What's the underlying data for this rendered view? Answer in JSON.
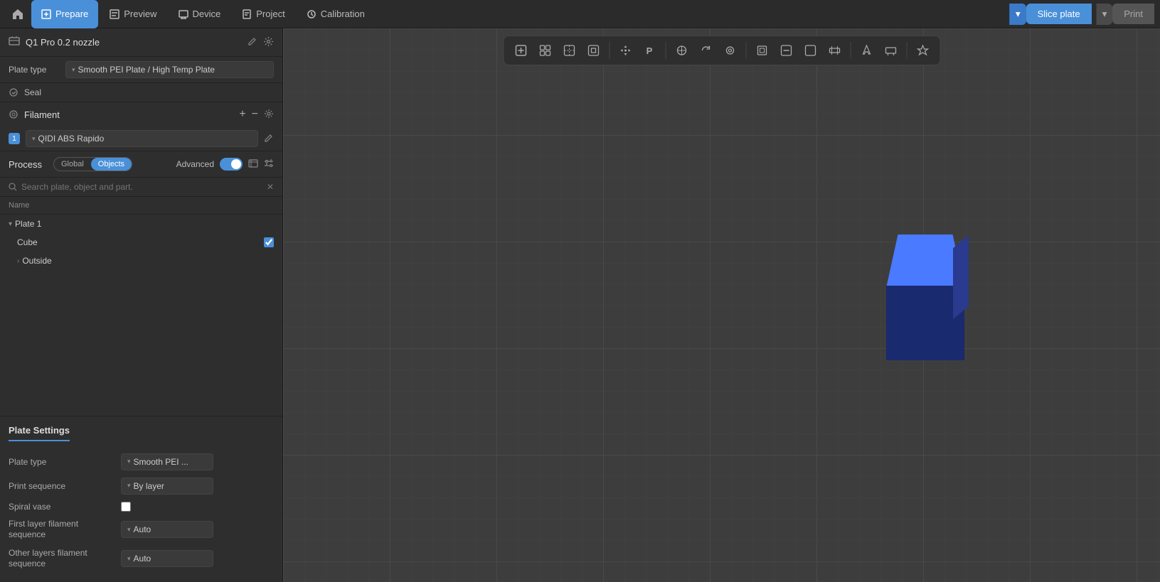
{
  "nav": {
    "home_icon": "⌂",
    "tabs": [
      {
        "id": "prepare",
        "label": "Prepare",
        "icon": "◻",
        "active": true
      },
      {
        "id": "preview",
        "label": "Preview",
        "icon": "◫",
        "active": false
      },
      {
        "id": "device",
        "label": "Device",
        "icon": "▣",
        "active": false
      },
      {
        "id": "project",
        "label": "Project",
        "icon": "◨",
        "active": false
      },
      {
        "id": "calibration",
        "label": "Calibration",
        "icon": "✦",
        "active": false
      }
    ],
    "slice_label": "Slice plate",
    "print_label": "Print"
  },
  "sidebar": {
    "printer_icon": "◻",
    "printer_name": "Q1 Pro 0.2 nozzle",
    "printer_edit_icon": "✎",
    "settings_icon": "⚙",
    "plate_type_label": "Plate type",
    "plate_type_value": "Smooth PEI Plate / High Temp Plate",
    "seal_icon": "○",
    "seal_label": "Seal",
    "filament_icon": "⊙",
    "filament_label": "Filament",
    "filament_add": "+",
    "filament_remove": "−",
    "filament_settings": "⚙",
    "filament_item": {
      "number": "1",
      "name": "QIDI ABS Rapido",
      "edit_icon": "✎"
    },
    "process_label": "Process",
    "toggle_global": "Global",
    "toggle_objects": "Objects",
    "advanced_label": "Advanced",
    "list_header": "Name",
    "items": [
      {
        "id": "plate1",
        "label": "Plate 1",
        "indent": 0,
        "chevron": true,
        "has_check": false
      },
      {
        "id": "cube",
        "label": "Cube",
        "indent": 1,
        "chevron": false,
        "has_check": true,
        "checked": true
      },
      {
        "id": "outside",
        "label": "Outside",
        "indent": 1,
        "chevron": true,
        "has_check": false
      }
    ]
  },
  "plate_settings": {
    "title": "Plate Settings",
    "rows": [
      {
        "id": "plate_type",
        "label": "Plate type",
        "value": "Smooth PEI ...",
        "type": "select"
      },
      {
        "id": "print_sequence",
        "label": "Print sequence",
        "value": "By layer",
        "type": "select"
      },
      {
        "id": "spiral_vase",
        "label": "Spiral vase",
        "value": "",
        "type": "checkbox"
      },
      {
        "id": "first_layer_filament",
        "label": "First layer filament sequence",
        "value": "Auto",
        "type": "select"
      },
      {
        "id": "other_layers_filament",
        "label": "Other layers filament sequence",
        "value": "Auto",
        "type": "select"
      }
    ]
  },
  "search": {
    "placeholder": "Search plate, object and part.",
    "clear_icon": "✕"
  },
  "toolbar": {
    "buttons": [
      "⊕",
      "⊞",
      "✂",
      "⊟",
      "|",
      "⊔",
      "P",
      "|",
      "✛",
      "↺",
      "◎",
      "|",
      "⊡",
      "□",
      "□",
      "□",
      "|",
      "↗",
      "◱",
      "|",
      "☆"
    ]
  }
}
